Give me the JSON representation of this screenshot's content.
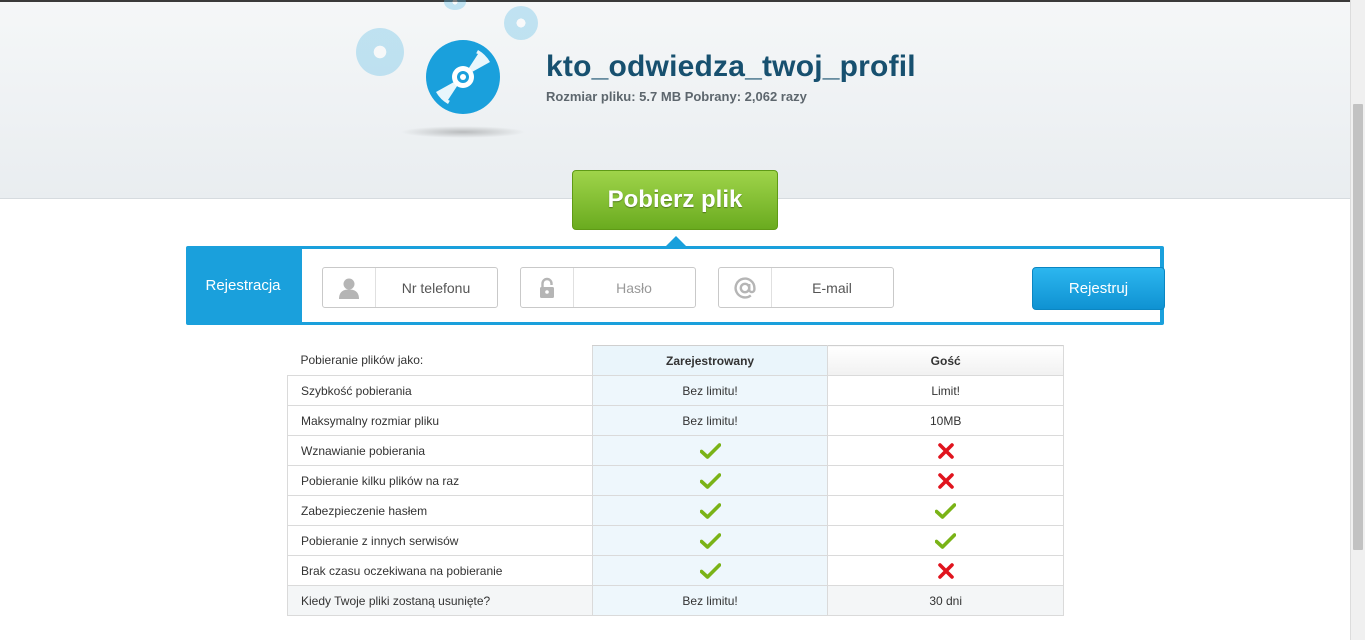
{
  "file": {
    "title": "kto_odwiedza_twoj_profil",
    "meta": "Rozmiar pliku: 5.7 MB Pobrany: 2,062 razy"
  },
  "download": {
    "button_label": "Pobierz plik"
  },
  "registration": {
    "label": "Rejestracja",
    "phone_placeholder": "Nr telefonu",
    "password_placeholder": "Hasło",
    "email_placeholder": "E-mail",
    "submit_label": "Rejestruj"
  },
  "comparison": {
    "header_feature": "Pobieranie plików jako:",
    "header_registered": "Zarejestrowany",
    "header_guest": "Gość",
    "rows": [
      {
        "feature": "Szybkość pobierania",
        "registered": "Bez limitu!",
        "guest": "Limit!"
      },
      {
        "feature": "Maksymalny rozmiar pliku",
        "registered": "Bez limitu!",
        "guest": "10MB"
      },
      {
        "feature": "Wznawianie pobierania",
        "registered": "check",
        "guest": "cross"
      },
      {
        "feature": "Pobieranie kilku plików na raz",
        "registered": "check",
        "guest": "cross"
      },
      {
        "feature": "Zabezpieczenie hasłem",
        "registered": "check",
        "guest": "check"
      },
      {
        "feature": "Pobieranie z innych serwisów",
        "registered": "check",
        "guest": "check"
      },
      {
        "feature": "Brak czasu oczekiwana na pobieranie",
        "registered": "check",
        "guest": "cross"
      },
      {
        "feature": "Kiedy Twoje pliki zostaną usunięte?",
        "registered": "Bez limitu!",
        "guest": "30 dni"
      }
    ]
  },
  "colors": {
    "accent_blue": "#1aa0dc",
    "title_color": "#17506f",
    "download_green": "#7dbd2a",
    "check_green": "#7ab317",
    "cross_red": "#e0141e"
  },
  "icons": {
    "disc": "cd-disc-icon",
    "phone_field": "user-silhouette-icon",
    "password_field": "padlock-icon",
    "email_field": "at-sign-icon",
    "yes": "check-icon",
    "no": "cross-icon"
  }
}
